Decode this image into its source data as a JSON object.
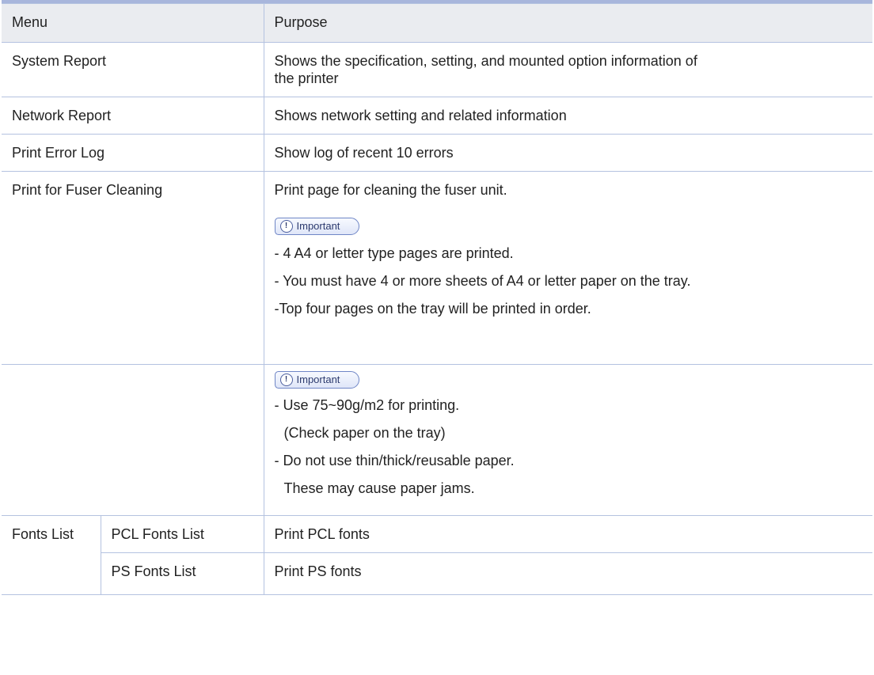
{
  "table": {
    "header": {
      "menu": "Menu",
      "purpose": "Purpose"
    },
    "rows": [
      {
        "menu": "System Report",
        "purpose": [
          "Shows the specification, setting, and mounted option information of",
          "the printer"
        ]
      },
      {
        "menu": "Network Report",
        "purpose": [
          "Shows network setting and related information"
        ]
      },
      {
        "menu": "Print Error Log",
        "purpose": [
          "Show log of recent 10 errors"
        ]
      },
      {
        "menu": "Print for Fuser Cleaning",
        "purpose": [
          "Print page for cleaning the fuser unit."
        ],
        "important_label": "Important",
        "notes": [
          "- 4 A4 or letter type pages are printed.",
          "- You must have 4 or more sheets of A4 or letter paper on the tray.",
          "-Top four pages on the tray will be printed in order."
        ]
      },
      {
        "menu": "",
        "important_label": "Important",
        "notes": [
          "-  Use 75~90g/m2 for printing.",
          "(Check paper on the tray)",
          "-  Do not use thin/thick/reusable paper.",
          "These may cause paper jams."
        ]
      },
      {
        "menu_group": "Fonts List",
        "menu": "PCL Fonts List",
        "purpose": [
          "Print PCL fonts"
        ]
      },
      {
        "menu_group": "",
        "menu": "PS Fonts List",
        "purpose": [
          "Print PS fonts"
        ]
      }
    ],
    "icons": {
      "important_icon": "alert-circle-icon"
    },
    "colors": {
      "border": "#b4c2e0",
      "header_bg": "#eaecf0",
      "top_rule": "#a8b6dc"
    }
  }
}
